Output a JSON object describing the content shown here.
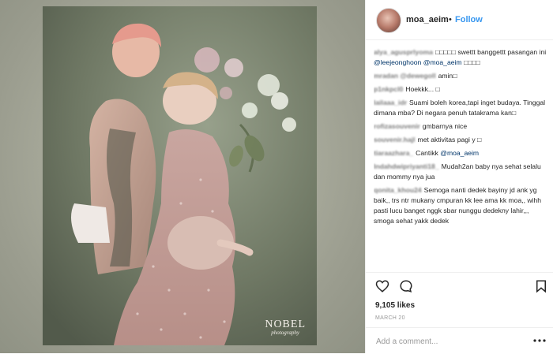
{
  "photo": {
    "watermark_main": "NOBEL",
    "watermark_sub": "photography"
  },
  "post": {
    "username": "moa_aeim",
    "separator": "•",
    "follow_label": "Follow"
  },
  "comments": [
    {
      "user": "alya_agusprlyoma",
      "parts": [
        {
          "t": "text",
          "v": "□□□□□ swettt banggettt pasangan ini "
        },
        {
          "t": "mention",
          "v": "@leejeonghoon"
        },
        {
          "t": "text",
          "v": " "
        },
        {
          "t": "mention",
          "v": "@moa_aeim"
        },
        {
          "t": "text",
          "v": " □□□□"
        }
      ]
    },
    {
      "user": "mradan @dewegoll",
      "parts": [
        {
          "t": "text",
          "v": "amin□"
        }
      ]
    },
    {
      "user": "p1nkpcl0",
      "parts": [
        {
          "t": "text",
          "v": "Hoekkk... □"
        }
      ]
    },
    {
      "user": "lailaaa_idr",
      "parts": [
        {
          "t": "text",
          "v": "Suami boleh korea,tapi inget budaya. Tinggal dimana mba? Di negara penuh tatakrama kan□"
        }
      ]
    },
    {
      "user": "rofizasouvenir",
      "parts": [
        {
          "t": "text",
          "v": "gmbarnya nice"
        }
      ]
    },
    {
      "user": "souvenir.hajl",
      "parts": [
        {
          "t": "text",
          "v": "met aktivitas pagi y □"
        }
      ]
    },
    {
      "user": "tiaraazhara_",
      "parts": [
        {
          "t": "text",
          "v": "Cantikk "
        },
        {
          "t": "mention",
          "v": "@moa_aeim"
        }
      ]
    },
    {
      "user": "Indahdwipriyanti18_",
      "parts": [
        {
          "t": "text",
          "v": "Mudah2an baby nya sehat selalu dan mommy nya jua"
        }
      ]
    },
    {
      "user": "qonita_khou24",
      "parts": [
        {
          "t": "text",
          "v": "Semoga nanti dedek bayiny jd ank yg baik,, trs ntr mukany cmpuran kk lee ama kk moa,, wihh pasti lucu banget nggk sbar nunggu dedekny lahir,,, smoga sehat yakk dedek"
        }
      ]
    }
  ],
  "actions": {
    "likes": "9,105 likes",
    "date": "MARCH 20",
    "comment_placeholder": "Add a comment..."
  },
  "icons": {
    "like": "heart-icon",
    "comment": "comment-bubble-icon",
    "save": "bookmark-icon",
    "options": "more-options-icon"
  }
}
